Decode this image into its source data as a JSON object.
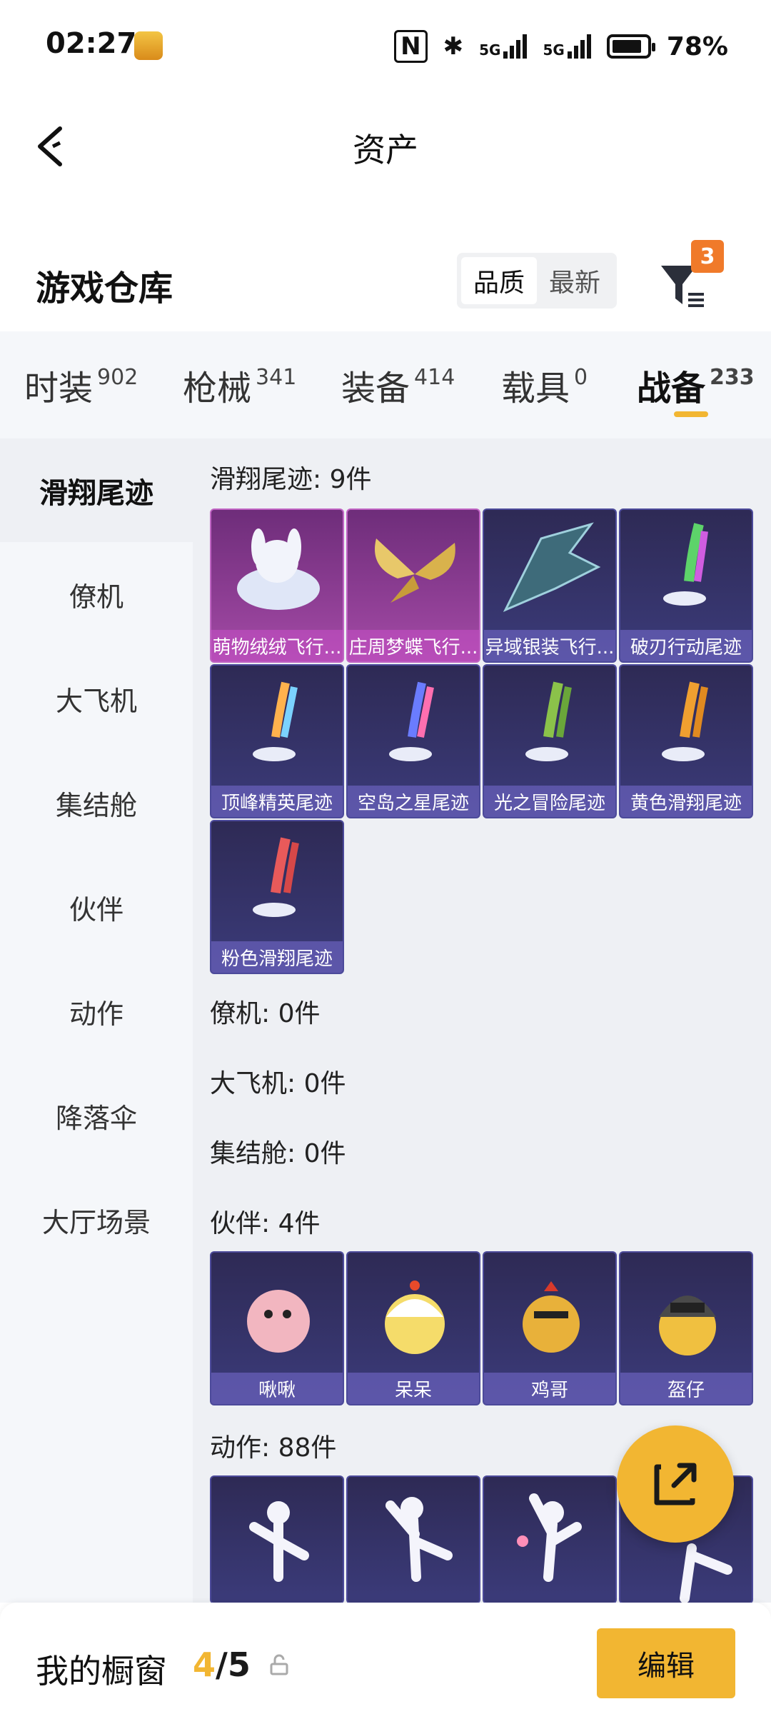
{
  "status_bar": {
    "time": "02:27",
    "battery": "78%",
    "net1": "5G",
    "net2": "5G"
  },
  "header": {
    "title": "资产"
  },
  "warehouse": {
    "title": "游戏仓库",
    "sort_options": [
      "品质",
      "最新"
    ],
    "filter_badge": "3"
  },
  "tabs": [
    {
      "label": "时装",
      "count": "902"
    },
    {
      "label": "枪械",
      "count": "341"
    },
    {
      "label": "装备",
      "count": "414"
    },
    {
      "label": "载具",
      "count": "0"
    },
    {
      "label": "战备",
      "count": "233"
    }
  ],
  "sidebar": [
    "滑翔尾迹",
    "僚机",
    "大飞机",
    "集结舱",
    "伙伴",
    "动作",
    "降落伞",
    "大厅场景"
  ],
  "sections": {
    "glide_trail": {
      "title": "滑翔尾迹: 9件",
      "items": [
        "萌物绒绒飞行...",
        "庄周梦蝶飞行...",
        "异域银装飞行...",
        "破刃行动尾迹",
        "顶峰精英尾迹",
        "空岛之星尾迹",
        "光之冒险尾迹",
        "黄色滑翔尾迹",
        "粉色滑翔尾迹"
      ]
    },
    "wingman": {
      "title": "僚机: 0件"
    },
    "big_plane": {
      "title": "大飞机: 0件"
    },
    "pod": {
      "title": "集结舱: 0件"
    },
    "companion": {
      "title": "伙伴: 4件",
      "items": [
        "啾啾",
        "呆呆",
        "鸡哥",
        "盔仔"
      ]
    },
    "emote": {
      "title": "动作: 88件"
    }
  },
  "bottom_bar": {
    "label": "我的橱窗",
    "current": "4",
    "total": "/5",
    "edit_label": "编辑"
  },
  "colors": {
    "accent": "#f2b632",
    "badge": "#f07a2a",
    "card_dark": "#2e2a55",
    "card_purple": "#a44aa6"
  }
}
